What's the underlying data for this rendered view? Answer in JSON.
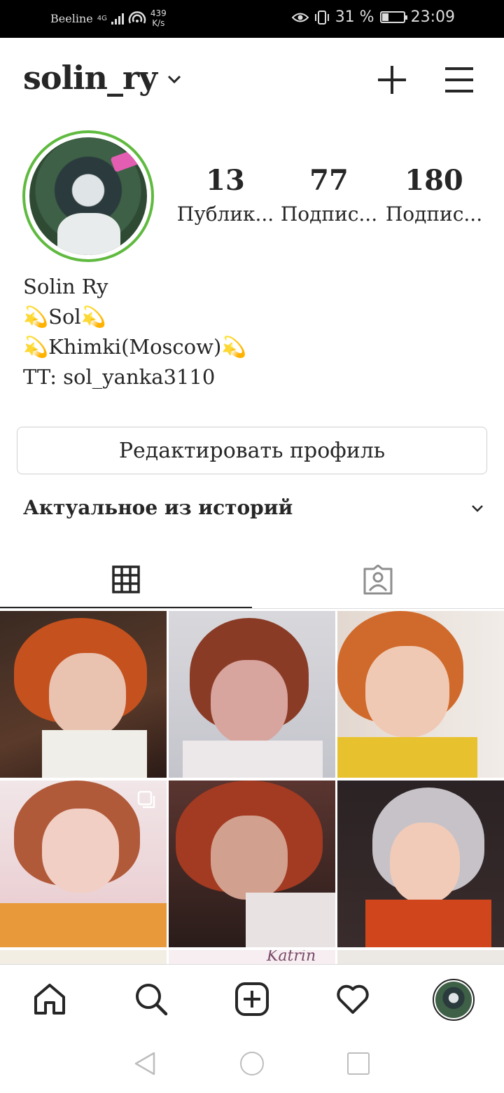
{
  "status_bar": {
    "carrier": "Beeline",
    "network": "4G",
    "speed_value": "439",
    "speed_unit": "K/s",
    "battery": "31 %",
    "battery_level": 0.31,
    "time": "23:09"
  },
  "header": {
    "username": "solin_ry"
  },
  "stats": {
    "posts": {
      "value": "13",
      "label": "Публик..."
    },
    "followers": {
      "value": "77",
      "label": "Подпис..."
    },
    "following": {
      "value": "180",
      "label": "Подпис..."
    }
  },
  "bio": {
    "name": "Solin Ry",
    "line1": "💫Sol💫",
    "line2": "💫Khimki(Moscow)💫",
    "line3": "TT: sol_yanka3110"
  },
  "edit_profile_label": "Редактировать профиль",
  "highlights_title": "Актуальное из историй",
  "grid_partial_text": "Katrin",
  "colors": {
    "story_ring": "#5fba3f",
    "text": "#262626",
    "divider": "#dbdbdb"
  }
}
